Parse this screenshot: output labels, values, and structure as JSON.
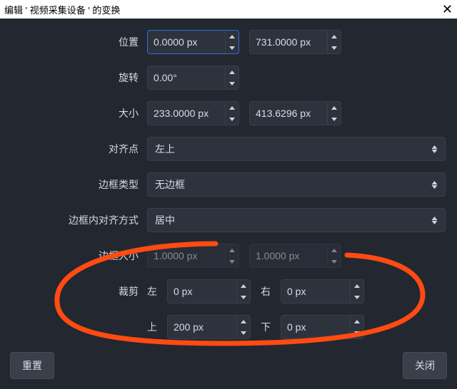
{
  "titlebar": {
    "title": "编辑 ' 视频采集设备 ' 的变换",
    "close": "✕"
  },
  "labels": {
    "position": "位置",
    "rotation": "旋转",
    "size": "大小",
    "alignment": "对齐点",
    "bbox_type": "边框类型",
    "bbox_align": "边框内对齐方式",
    "bbox_size": "边框大小",
    "crop": "裁剪"
  },
  "sides": {
    "left": "左",
    "right": "右",
    "top": "上",
    "bottom": "下"
  },
  "values": {
    "position_x": "0.0000 px",
    "position_y": "731.0000 px",
    "rotation": "0.00°",
    "size_w": "233.0000 px",
    "size_h": "413.6296 px",
    "alignment": "左上",
    "bbox_type": "无边框",
    "bbox_align": "居中",
    "bbox_size_w": "1.0000 px",
    "bbox_size_h": "1.0000 px",
    "crop_left": "0 px",
    "crop_right": "0 px",
    "crop_top": "200 px",
    "crop_bottom": "0 px"
  },
  "buttons": {
    "reset": "重置",
    "close": "关闭"
  }
}
